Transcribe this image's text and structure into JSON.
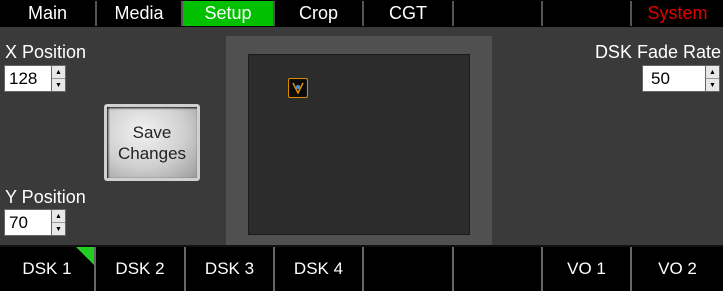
{
  "top_tabs": [
    {
      "label": "Main"
    },
    {
      "label": "Media"
    },
    {
      "label": "Setup",
      "active": true
    },
    {
      "label": "Crop"
    },
    {
      "label": "CGT"
    },
    {
      "label": ""
    },
    {
      "label": ""
    },
    {
      "label": "System",
      "color": "#e00000"
    }
  ],
  "x_position": {
    "label": "X Position",
    "value": "128"
  },
  "y_position": {
    "label": "Y Position",
    "value": "70"
  },
  "dsk_fade_rate": {
    "label": "DSK Fade Rate",
    "value": "50"
  },
  "save_button": {
    "line1": "Save",
    "line2": "Changes"
  },
  "preview": {
    "marker_icon": "dsk-graphic-icon"
  },
  "bottom_tabs": [
    {
      "label": "DSK 1",
      "active": true
    },
    {
      "label": "DSK 2"
    },
    {
      "label": "DSK 3"
    },
    {
      "label": "DSK 4"
    },
    {
      "label": ""
    },
    {
      "label": ""
    },
    {
      "label": "VO 1"
    },
    {
      "label": "VO 2"
    }
  ],
  "colors": {
    "active_tab": "#00c000",
    "system_text": "#e00000",
    "active_corner": "#22cc22"
  }
}
